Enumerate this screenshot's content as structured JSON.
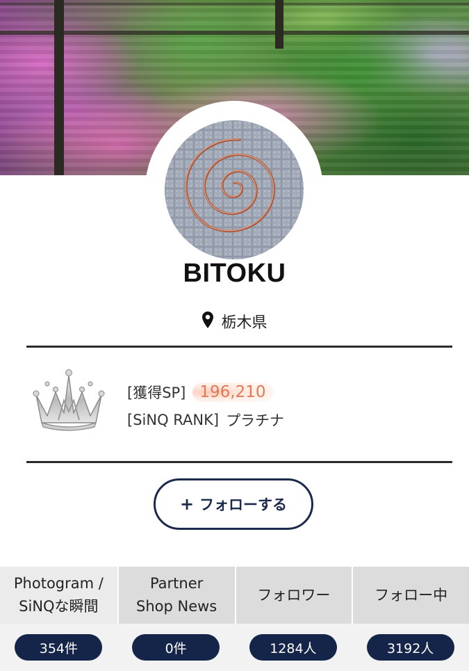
{
  "profile": {
    "name": "BITOKU",
    "location": "栃木県"
  },
  "rank": {
    "sp_label": "[獲得SP]",
    "sp_value": "196,210",
    "rank_label": "[SiNQ RANK]",
    "rank_value": "プラチナ"
  },
  "follow": {
    "plus": "+",
    "label": "フォローする"
  },
  "tabs": [
    {
      "line1": "Photogram /",
      "line2": "SiNQな瞬間",
      "count": "354件"
    },
    {
      "line1": "Partner",
      "line2": "Shop News",
      "count": "0件"
    },
    {
      "line1": "フォロワー",
      "line2": "",
      "count": "1284人"
    },
    {
      "line1": "フォロー中",
      "line2": "",
      "count": "3192人"
    }
  ],
  "icons": {
    "location": "map-pin-icon",
    "rank_badge": "crown-icon",
    "avatar": "spiral-wire-photo"
  },
  "colors": {
    "navy": "#152449",
    "sp_highlight": "#e07a55",
    "tab_bg": "#dcdcdc"
  }
}
